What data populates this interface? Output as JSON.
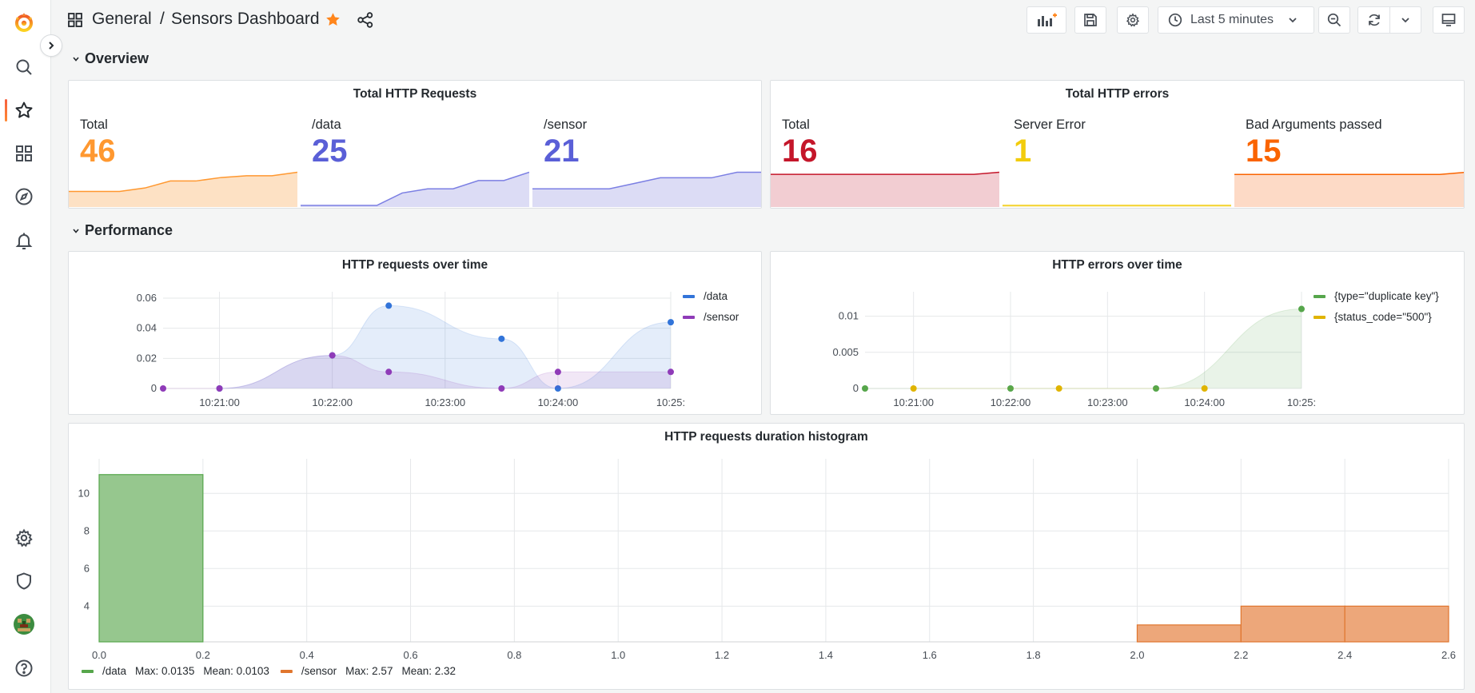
{
  "breadcrumb": {
    "folder": "General",
    "separator": "/",
    "dashboard": "Sensors Dashboard"
  },
  "toolbar": {
    "time_range": "Last 5 minutes"
  },
  "rows": {
    "overview": "Overview",
    "performance": "Performance"
  },
  "colors": {
    "orange": "#ff9830",
    "blue_purple": "#5a5fd7",
    "red": "#c4162a",
    "yellow": "#f2cc0c",
    "dark_orange": "#fa6400",
    "green": "#56a64b",
    "line_blue": "#3274d9",
    "line_purple": "#8f3bb8",
    "hist_orange": "#e0752d"
  },
  "panels": {
    "total_requests": {
      "title": "Total HTTP Requests",
      "stats": [
        {
          "label": "Total",
          "value": "46",
          "spark": [
            8,
            8,
            8,
            10,
            14,
            14,
            16,
            17,
            17,
            19
          ]
        },
        {
          "label": "/data",
          "value": "25",
          "spark": [
            0,
            0,
            0,
            0,
            3,
            4,
            4,
            6,
            6,
            8
          ]
        },
        {
          "label": "/sensor",
          "value": "21",
          "spark": [
            3,
            3,
            3,
            3,
            4,
            5,
            5,
            5,
            6,
            6
          ]
        }
      ]
    },
    "total_errors": {
      "title": "Total HTTP errors",
      "stats": [
        {
          "label": "Total",
          "value": "16",
          "spark": [
            15,
            15,
            15,
            15,
            15,
            15,
            15,
            15,
            15,
            16
          ]
        },
        {
          "label": "Server Error",
          "value": "1",
          "spark": [
            0,
            0,
            0,
            0,
            0,
            0,
            0,
            0,
            0,
            0
          ]
        },
        {
          "label": "Bad Arguments passed",
          "value": "15",
          "spark": [
            14,
            14,
            14,
            14,
            14,
            14,
            14,
            14,
            14,
            15
          ]
        }
      ]
    },
    "requests_over_time": {
      "title": "HTTP requests over time"
    },
    "errors_over_time": {
      "title": "HTTP errors over time"
    },
    "histogram": {
      "title": "HTTP requests duration histogram"
    }
  },
  "chart_data": [
    {
      "type": "line",
      "title": "HTTP requests over time",
      "x_ticks": [
        "10:21:00",
        "10:22:00",
        "10:23:00",
        "10:24:00",
        "10:25:"
      ],
      "y_ticks": [
        "0",
        "0.02",
        "0.04",
        "0.06"
      ],
      "ylim": [
        0,
        0.06
      ],
      "xlim_minutes": [
        -0.5,
        4.0
      ],
      "legend_position": "right",
      "series": [
        {
          "name": "/data",
          "points": [
            [
              0.0,
              0
            ],
            [
              1.0,
              0.022
            ],
            [
              1.5,
              0.055
            ],
            [
              2.5,
              0.033
            ],
            [
              3.0,
              0
            ],
            [
              4.0,
              0.044
            ]
          ]
        },
        {
          "name": "/sensor",
          "points": [
            [
              -0.5,
              0
            ],
            [
              0.0,
              0
            ],
            [
              1.0,
              0.022
            ],
            [
              1.5,
              0.011
            ],
            [
              2.5,
              0
            ],
            [
              3.0,
              0.011
            ],
            [
              4.0,
              0.011
            ]
          ]
        }
      ]
    },
    {
      "type": "line",
      "title": "HTTP errors over time",
      "x_ticks": [
        "10:21:00",
        "10:22:00",
        "10:23:00",
        "10:24:00",
        "10:25:"
      ],
      "y_ticks": [
        "0",
        "0.005",
        "0.01"
      ],
      "ylim": [
        0,
        0.0125
      ],
      "xlim_minutes": [
        -0.5,
        4.0
      ],
      "legend_position": "right",
      "series": [
        {
          "name": "{type=\"duplicate key\"}",
          "points": [
            [
              -0.5,
              0
            ],
            [
              1.0,
              0
            ],
            [
              2.5,
              0
            ],
            [
              4.0,
              0.011
            ]
          ]
        },
        {
          "name": "{status_code=\"500\"}",
          "points": [
            [
              0.0,
              0
            ],
            [
              1.5,
              0
            ],
            [
              3.0,
              0
            ]
          ]
        }
      ]
    },
    {
      "type": "bar",
      "title": "HTTP requests duration histogram",
      "x_ticks": [
        "0.0",
        "0.2",
        "0.4",
        "0.6",
        "0.8",
        "1.0",
        "1.2",
        "1.4",
        "1.6",
        "1.8",
        "2.0",
        "2.2",
        "2.4",
        "2.6"
      ],
      "y_ticks": [
        "4",
        "8",
        "6",
        "10"
      ],
      "y_ticks_ordered": [
        "4",
        "6",
        "8",
        "10"
      ],
      "xlim": [
        0,
        2.6
      ],
      "ylim": [
        2.1,
        11.5
      ],
      "series": [
        {
          "name": "/data",
          "max": "Max: 0.0135",
          "mean": "Mean: 0.0103",
          "bins": [
            [
              0.0,
              0.2,
              11
            ]
          ]
        },
        {
          "name": "/sensor",
          "max": "Max: 2.57",
          "mean": "Mean: 2.32",
          "bins": [
            [
              2.0,
              2.2,
              3
            ],
            [
              2.2,
              2.4,
              4
            ],
            [
              2.4,
              2.6,
              4
            ]
          ]
        }
      ]
    }
  ]
}
